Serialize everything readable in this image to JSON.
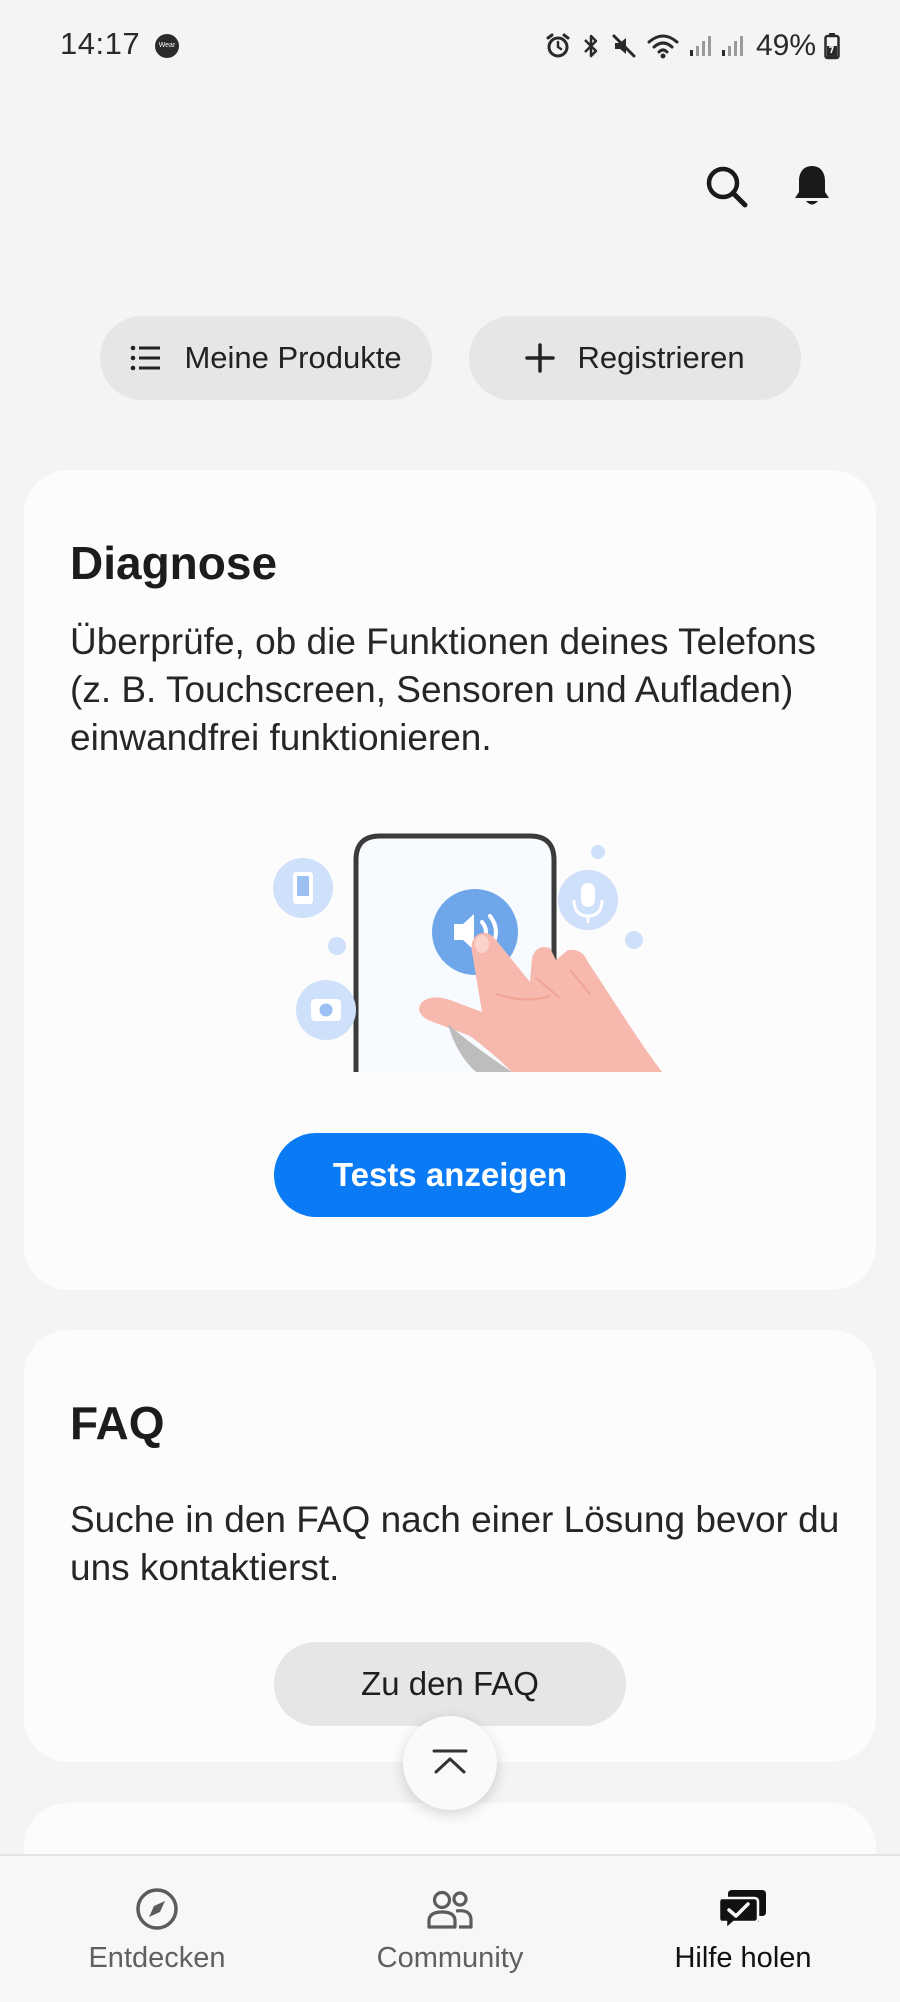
{
  "status_bar": {
    "time": "14:17",
    "badge": "Wear",
    "battery": "49%",
    "icons": [
      "alarm-icon",
      "bluetooth-icon",
      "mute-icon",
      "wifi-icon",
      "signal-icon",
      "signal-icon",
      "battery-icon"
    ]
  },
  "header": {
    "icons": [
      "search-icon",
      "bell-icon"
    ]
  },
  "chips": {
    "my_products": "Meine Produkte",
    "register": "Registrieren"
  },
  "diagnosis": {
    "title": "Diagnose",
    "description": "Überprüfe, ob die Funktionen deines Telefons (z. B. Touchscreen, Sensoren und Aufladen) einwandfrei funktionieren.",
    "button": "Tests anzeigen",
    "illustration_icons": [
      "phone-icon",
      "camera-icon",
      "speaker-icon",
      "microphone-icon",
      "hand-icon"
    ]
  },
  "faq": {
    "title": "FAQ",
    "description": "Suche in den FAQ nach einer Lösung bevor du uns kontaktierst.",
    "button": "Zu den FAQ"
  },
  "bottom_nav": {
    "items": [
      {
        "label": "Entdecken",
        "icon": "compass-icon",
        "active": false
      },
      {
        "label": "Community",
        "icon": "people-icon",
        "active": false
      },
      {
        "label": "Hilfe holen",
        "icon": "chat-check-icon",
        "active": true
      }
    ]
  },
  "colors": {
    "accent": "#0a7bf5",
    "background": "#f4f4f4",
    "card": "#fcfcfc",
    "chip": "#e6e6e6",
    "illustration_blue": "#6fa6ea",
    "illustration_light_blue": "#cfe0fb",
    "hand": "#f7b8ad"
  }
}
